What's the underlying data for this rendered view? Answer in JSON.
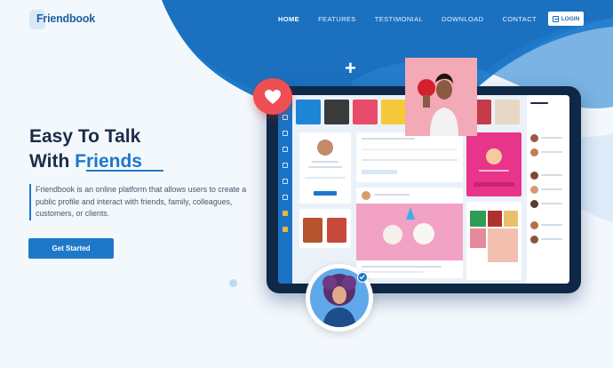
{
  "brand": {
    "name": "Friendbook"
  },
  "nav": {
    "items": [
      {
        "label": "HOME",
        "active": true
      },
      {
        "label": "FEATURES"
      },
      {
        "label": "TESTIMONIAL"
      },
      {
        "label": "DOWNLOAD"
      },
      {
        "label": "CONTACT"
      }
    ],
    "login_label": "LOGIN"
  },
  "hero": {
    "title_line1": "Easy To Talk",
    "title_line2_prefix": "With ",
    "title_line2_highlight": "Friends",
    "description": "Friendbook is an online platform that allows users to create a public profile and interact with friends, family, colleagues, customers, or clients.",
    "cta_label": "Get Started"
  },
  "colors": {
    "brand_blue": "#1e78c9",
    "dark_navy": "#1c2c48",
    "heart_red": "#ef4f52",
    "background": "#f3f8fd"
  },
  "icons": [
    "login-icon",
    "heart-icon",
    "plus-icon",
    "verified-check-icon"
  ]
}
